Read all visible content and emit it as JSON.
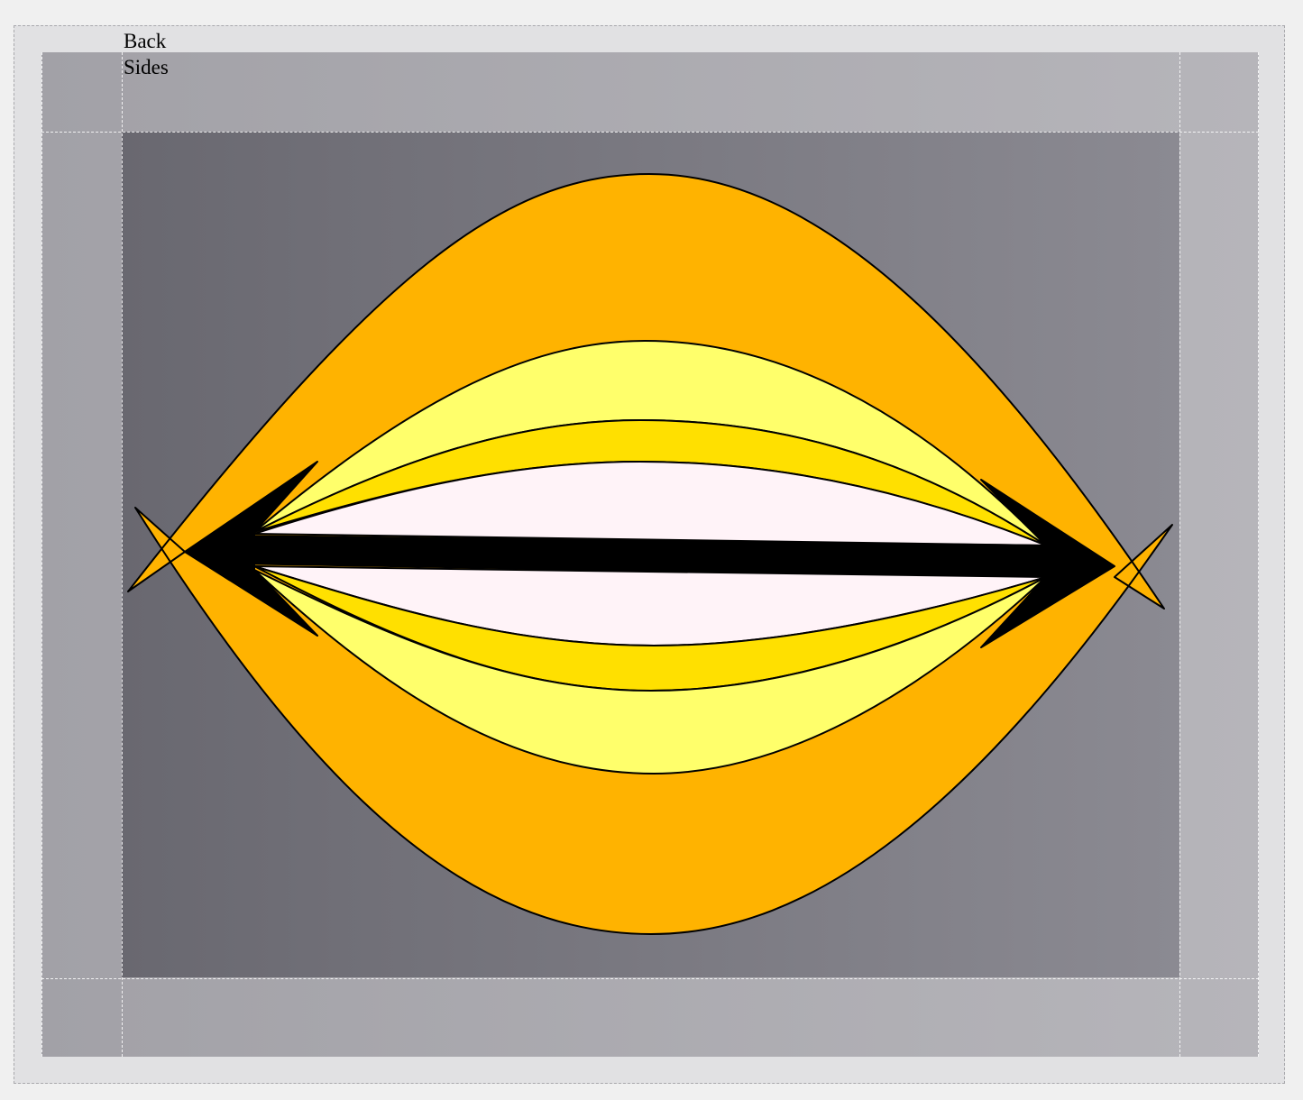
{
  "labels": {
    "back": "Back",
    "sides": "Sides"
  },
  "colors": {
    "outer_frame": "#e1e1e3",
    "side_band_left": "#a2a1a7",
    "side_band_right": "#b6b5ba",
    "back_panel_left": "#696870",
    "back_panel_right": "#8b8a92",
    "orange": "#ffb300",
    "light_yellow": "#ffff6b",
    "gold": "#ffe000",
    "pale_pink": "#fff3f8",
    "black": "#000000"
  }
}
